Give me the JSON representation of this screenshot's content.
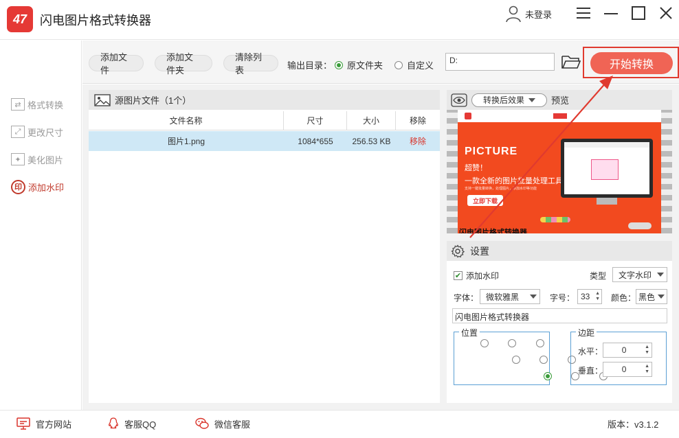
{
  "app": {
    "title": "闪电图片格式转换器",
    "logo_text": "47"
  },
  "user": {
    "label": "未登录"
  },
  "sidebar": {
    "items": [
      {
        "label": "格式转换",
        "icon": "convert-icon",
        "active": false
      },
      {
        "label": "更改尺寸",
        "icon": "resize-icon",
        "active": false
      },
      {
        "label": "美化图片",
        "icon": "beautify-icon",
        "active": false
      },
      {
        "label": "添加水印",
        "icon": "watermark-icon",
        "icon_text": "印",
        "active": true
      }
    ]
  },
  "toolbar": {
    "add_file": "添加文件",
    "add_folder": "添加文件夹",
    "clear_list": "清除列表",
    "output_label": "输出目录：",
    "option_source": "原文件夹",
    "option_custom": "自定义",
    "selected_option": "原文件夹",
    "dir_value": "D:",
    "start": "开始转换"
  },
  "file_panel": {
    "header": "源图片文件（1个）",
    "columns": [
      "文件名称",
      "尺寸",
      "大小",
      "移除"
    ],
    "rows": [
      {
        "name": "图片1.png",
        "size": "1084*655",
        "filesize": "256.53 KB",
        "remove": "移除"
      }
    ]
  },
  "preview": {
    "mode": "转换后效果",
    "label": "预览",
    "image": {
      "headline": "PICTURE",
      "line1": "超赞！",
      "line2": "一款全新的图片批量处理工具",
      "line3": "支持一键批量转换，处理图片，添加水印等功能",
      "download": "立即下载",
      "watermark": "闪电图片格式转换器"
    }
  },
  "settings": {
    "title": "设置",
    "add_watermark": "添加水印",
    "add_watermark_checked": true,
    "type_label": "类型",
    "type_value": "文字水印",
    "font_label": "字体：",
    "font_value": "微软雅黑",
    "size_label": "字号：",
    "size_value": "33",
    "color_label": "颜色：",
    "color_value": "黑色",
    "text_value": "闪电图片格式转换器",
    "position_label": "位置",
    "position_selected": "bottom-left",
    "margin_label": "边距",
    "horizontal_label": "水平：",
    "horizontal_value": "0",
    "vertical_label": "垂直：",
    "vertical_value": "0"
  },
  "statusbar": {
    "website": "官方网站",
    "qq": "客服QQ",
    "wechat": "微信客服",
    "version": "版本：v3.1.2"
  },
  "colors": {
    "accent": "#f06455",
    "brand": "#e53935",
    "selection": "#cfe8f6",
    "annotation": "#e03a2f"
  }
}
